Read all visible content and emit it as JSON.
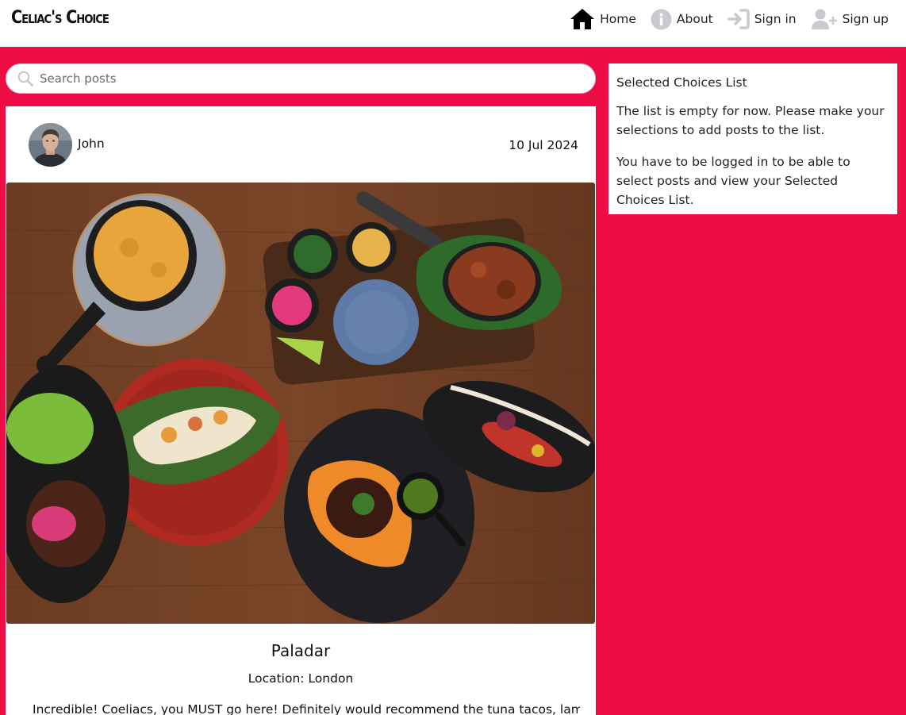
{
  "navbar": {
    "brand": "Celiac's Choice",
    "items": [
      {
        "label": "Home",
        "icon": "home-icon"
      },
      {
        "label": "About",
        "icon": "info-icon"
      },
      {
        "label": "Sign in",
        "icon": "sign-in-icon"
      },
      {
        "label": "Sign up",
        "icon": "user-plus-icon"
      }
    ]
  },
  "search": {
    "placeholder": "Search posts",
    "value": ""
  },
  "post": {
    "author": "John",
    "date": "10 Jul 2024",
    "title": "Paladar",
    "location": "Location: London",
    "content": "Incredible! Coeliacs, you MUST go here! Definitely would recommend the tuna tacos, lamb"
  },
  "sidebar": {
    "title": "Selected Choices List",
    "empty_text": "The list is empty for now. Please make your selections to add posts to the list.",
    "login_text": "You have to be logged in to be able to select posts and view your Selected Choices List."
  },
  "colors": {
    "accent": "#ee0c44",
    "panel": "#ffffff"
  }
}
